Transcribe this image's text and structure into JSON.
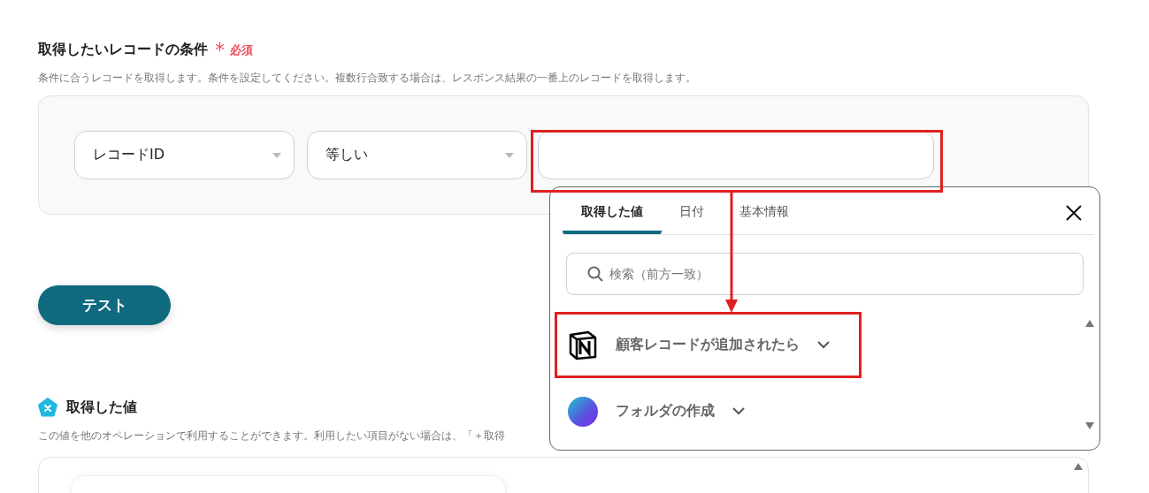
{
  "condition": {
    "title": "取得したいレコードの条件",
    "required_mark": "*",
    "required": "必須",
    "description": "条件に合うレコードを取得します。条件を設定してください。複数行合致する場合は、レスポンス結果の一番上のレコードを取得します。",
    "field_select": {
      "value": "レコードID"
    },
    "operator_select": {
      "value": "等しい"
    }
  },
  "test_button": {
    "label": "テスト"
  },
  "output": {
    "title": "取得した値",
    "description": "この値を他のオペレーションで利用することができます。利用したい項目がない場合は、「＋取得"
  },
  "popup": {
    "tabs": [
      {
        "label": "取得した値",
        "selected": true
      },
      {
        "label": "日付",
        "selected": false
      },
      {
        "label": "基本情報",
        "selected": false
      }
    ],
    "search": {
      "placeholder": "検索（前方一致）"
    },
    "items": [
      {
        "label": "顧客レコードが追加されたら",
        "kind": "notion",
        "highlighted": true
      },
      {
        "label": "フォルダの作成",
        "kind": "canva",
        "highlighted": false
      }
    ]
  }
}
